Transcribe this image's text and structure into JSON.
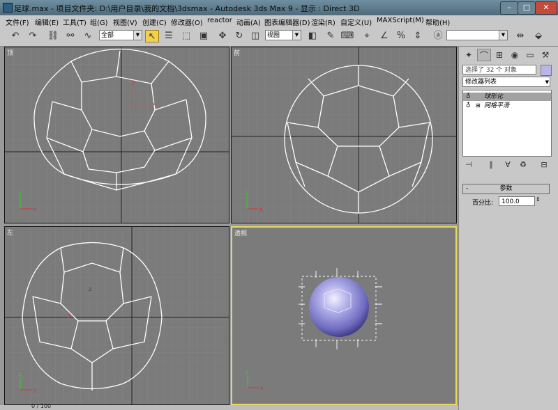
{
  "window": {
    "title": "足球.max  - 项目文件夹: D:\\用户目录\\我的文档\\3dsmax    - Autodesk 3ds Max 9     - 显示 : Direct 3D"
  },
  "menu": [
    "文件(F)",
    "编辑(E)",
    "工具(T)",
    "组(G)",
    "视图(V)",
    "创建(C)",
    "修改器(O)",
    "reactor",
    "动画(A)",
    "图表编辑器(D)",
    "渲染(R)",
    "自定义(U)",
    "MAXScript(M)",
    "帮助(H)"
  ],
  "toolbar": {
    "selection_filter": "全部",
    "reference_coord": "视图"
  },
  "viewports": {
    "top": "顶",
    "front": "前",
    "left": "左",
    "perspective": "透视"
  },
  "panel": {
    "selection_info": "选择了 32 个 对象",
    "modifier_list": "修改器列表",
    "stack": [
      {
        "label": "球形化",
        "selected": true
      },
      {
        "label": "网格平滑",
        "selected": false
      }
    ],
    "rollout_title": "参数",
    "percent_label": "百分比:",
    "percent_value": "100.0"
  },
  "status": {
    "frame_counter": "0 / 100"
  },
  "colors": {
    "viewport_bg": "#7b7b7b",
    "active_border": "#e7d75c",
    "wire": "#ffffff",
    "sphere": "#9a96e0"
  }
}
